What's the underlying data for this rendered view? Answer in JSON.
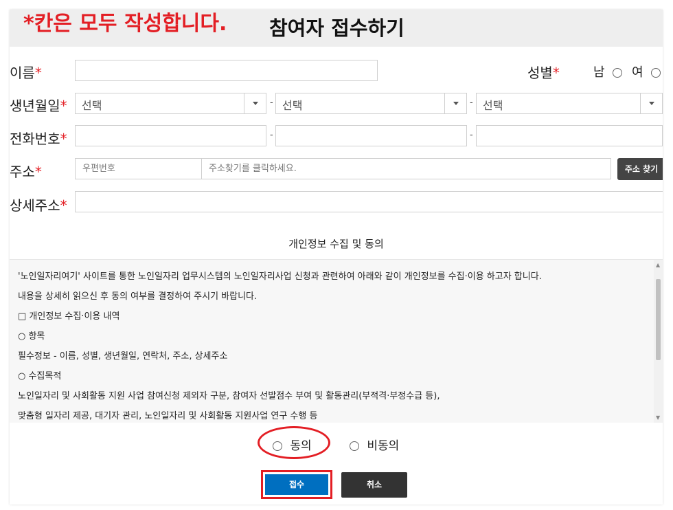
{
  "header": {
    "notice": "*칸은 모두 작성합니다.",
    "title": "참여자 접수하기"
  },
  "form": {
    "name_label": "이름",
    "gender_label": "성별",
    "gender_male": "남",
    "gender_female": "여",
    "birth_label": "생년월일",
    "birth_year": "선택",
    "birth_month": "선택",
    "birth_day": "선택",
    "phone_label": "전화번호",
    "address_label": "주소",
    "postcode_placeholder": "우편번호",
    "address_placeholder": "주소찾기를 클릭하세요.",
    "address_search_button": "주소 찾기",
    "detail_address_label": "상세주소",
    "required_mark": "*",
    "dash": "-"
  },
  "privacy": {
    "title": "개인정보 수집 및 동의",
    "lines": [
      "'노인일자리여기' 사이트를 통한 노인일자리 업무시스템의 노인일자리사업 신청과 관련하여 아래와 같이 개인정보를 수집·이용 하고자 합니다.",
      "내용을 상세히 읽으신 후 동의 여부를 결정하여 주시기 바랍니다.",
      "□ 개인정보 수집·이용 내역",
      "○ 항목",
      "필수정보 - 이름, 성별, 생년월일, 연락처, 주소, 상세주소",
      "○ 수집목적",
      "노인일자리 및 사회활동 지원 사업 참여신청 제외자 구분, 참여자 선발점수 부여 및 활동관리(부적격·부정수급 등),",
      "맞춤형 일자리 제공, 대기자 관리, 노인일자리 및 사회활동 지원사업 연구 수행 등"
    ],
    "agree_label": "동의",
    "disagree_label": "비동의"
  },
  "actions": {
    "submit_label": "접수",
    "cancel_label": "취소"
  },
  "colors": {
    "accent_red": "#e31e24",
    "submit_blue": "#006fc0",
    "dark_button": "#444444"
  }
}
